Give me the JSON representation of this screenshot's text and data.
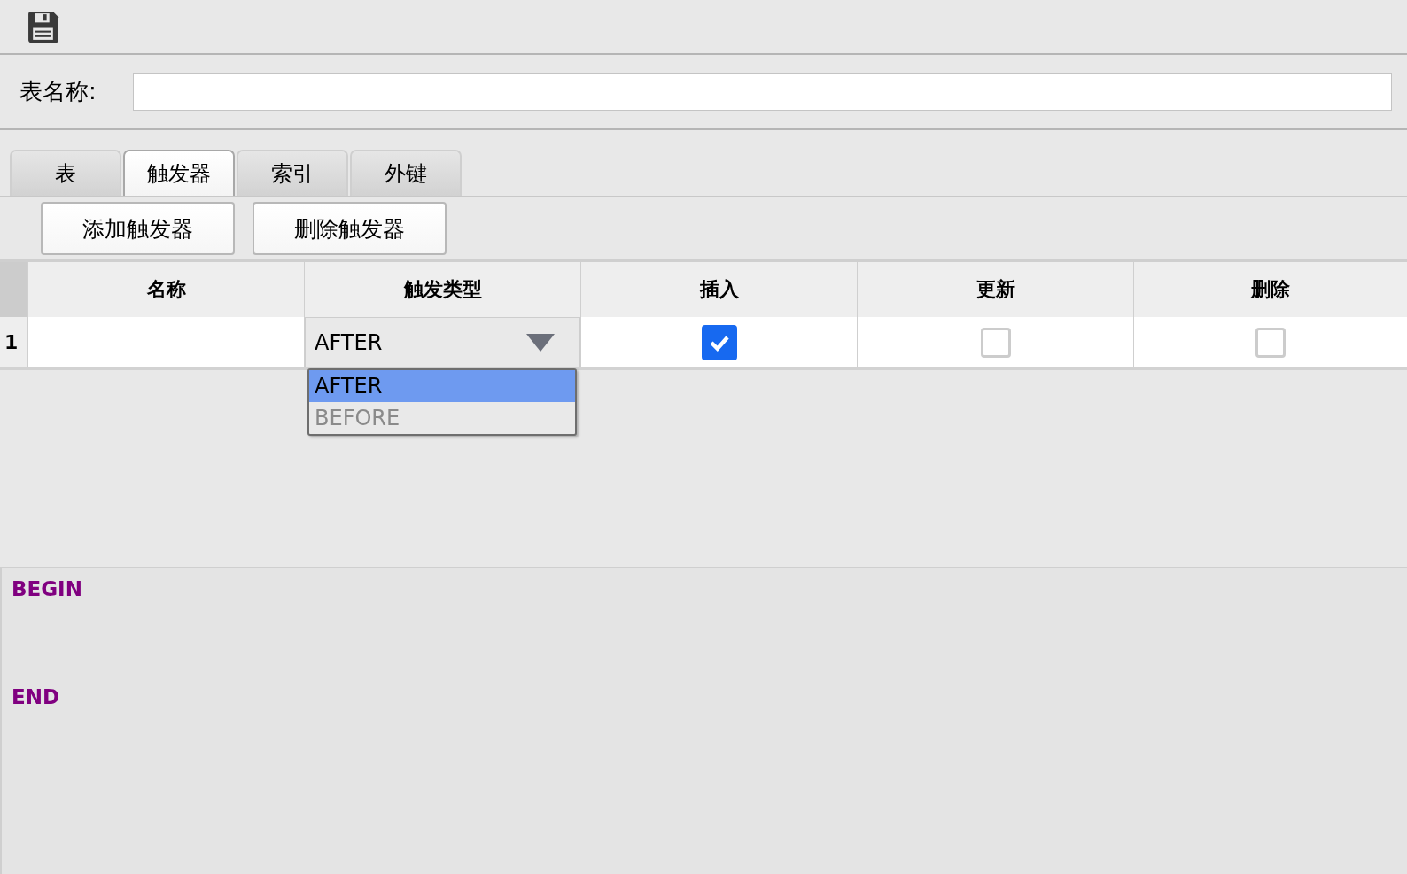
{
  "table_name": {
    "label": "表名称:"
  },
  "tabs": [
    {
      "label": "表",
      "selected": false
    },
    {
      "label": "触发器",
      "selected": true
    },
    {
      "label": "索引",
      "selected": false
    },
    {
      "label": "外键",
      "selected": false
    }
  ],
  "buttons": [
    "添加触发器",
    "删除触发器"
  ],
  "table": {
    "columns": [
      "名称",
      "触发类型",
      "插入",
      "更新",
      "删除"
    ],
    "rows": [
      {
        "row_number": "1",
        "trigger_type": "AFTER",
        "insert": true,
        "update": false,
        "delete": false
      }
    ]
  },
  "dropdown": {
    "options": [
      {
        "label": "AFTER",
        "selected": true
      },
      {
        "label": "BEFORE",
        "selected": false
      }
    ]
  },
  "editor": {
    "lines": [
      "BEGIN",
      "END"
    ]
  }
}
